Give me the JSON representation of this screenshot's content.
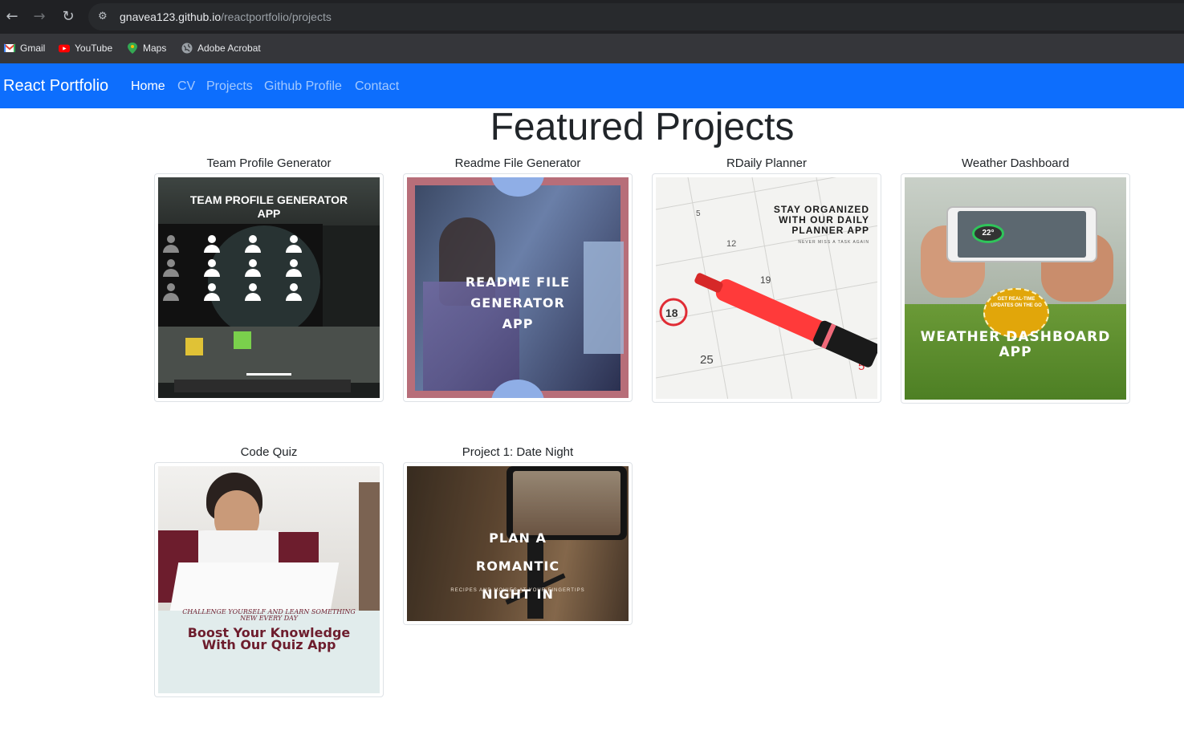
{
  "browser": {
    "url_host": "gnavea123.github.io",
    "url_path": "/reactportfolio/projects",
    "bookmarks": [
      {
        "label": "Gmail",
        "icon": "gmail-icon"
      },
      {
        "label": "YouTube",
        "icon": "youtube-icon"
      },
      {
        "label": "Maps",
        "icon": "maps-icon"
      },
      {
        "label": "Adobe Acrobat",
        "icon": "globe-icon"
      }
    ]
  },
  "navbar": {
    "brand": "React Portfolio",
    "links": [
      "Home",
      "CV",
      "Projects",
      "Github Profile",
      "Contact"
    ],
    "active_link": "Home",
    "color": "#0d6efd"
  },
  "page": {
    "title": "Featured Projects"
  },
  "projects": [
    {
      "title": "Team Profile Generator",
      "image_text": "TEAM PROFILE GENERATOR APP"
    },
    {
      "title": "Readme File Generator",
      "image_text": "README FILE GENERATOR APP"
    },
    {
      "title": "RDaily Planner",
      "image_text": "STAY ORGANIZED WITH OUR DAILY PLANNER APP",
      "image_subtext": "NEVER MISS A TASK AGAIN"
    },
    {
      "title": "Weather Dashboard",
      "image_text": "WEATHER DASHBOARD APP",
      "image_subtext": "GET REAL-TIME UPDATES ON THE GO"
    },
    {
      "title": "Code Quiz",
      "image_text": "Boost Your Knowledge With Our Quiz App",
      "image_subtext": "CHALLENGE YOURSELF AND LEARN SOMETHING NEW EVERY DAY"
    },
    {
      "title": "Project 1: Date Night",
      "image_text": "PLAN A ROMANTIC NIGHT IN",
      "image_subtext": "RECIPES AND MOVIES AT YOUR FINGERTIPS"
    }
  ]
}
